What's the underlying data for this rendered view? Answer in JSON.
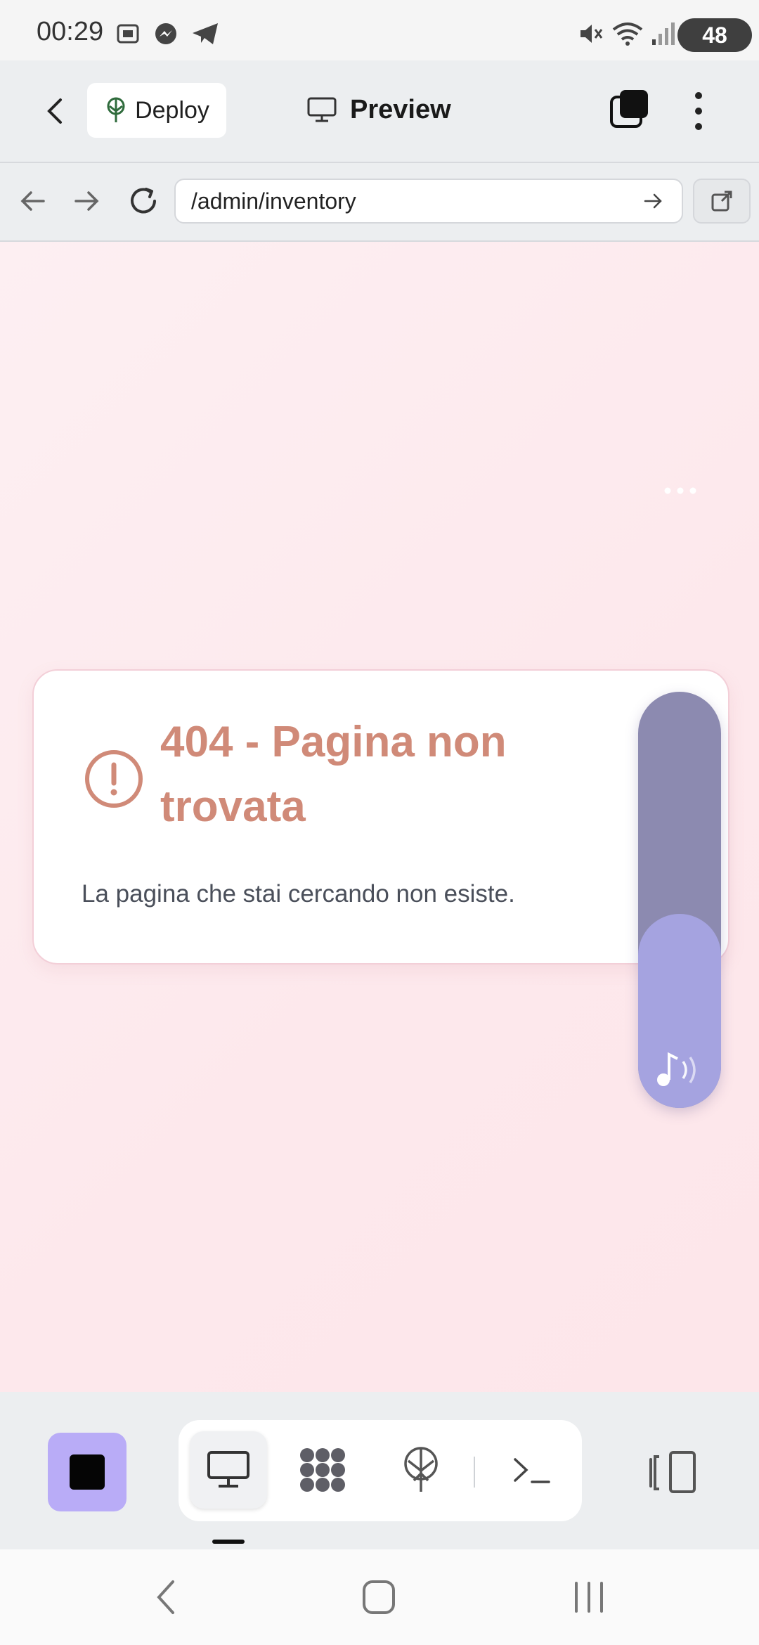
{
  "status_bar": {
    "time": "00:29",
    "battery": "48"
  },
  "app_bar": {
    "deploy_label": "Deploy",
    "title": "Preview"
  },
  "browser": {
    "url": "/admin/inventory"
  },
  "error_card": {
    "title": "404 - Pagina non trovata",
    "message": "La pagina che stai cercando non esiste."
  },
  "colors": {
    "accent_purple": "#b9acf7",
    "error_title": "#d08a78",
    "widget": "#8c8ab0",
    "page_bg": "#fdeff2"
  },
  "icons": {
    "status_left": [
      "screenshot-icon",
      "messenger-icon",
      "telegram-icon"
    ],
    "status_right": [
      "mute-icon",
      "wifi-icon",
      "signal-icon"
    ],
    "toolbar": [
      "monitor-icon",
      "nodes-icon",
      "deploy-tree-icon",
      "terminal-icon",
      "split-view-icon"
    ]
  }
}
